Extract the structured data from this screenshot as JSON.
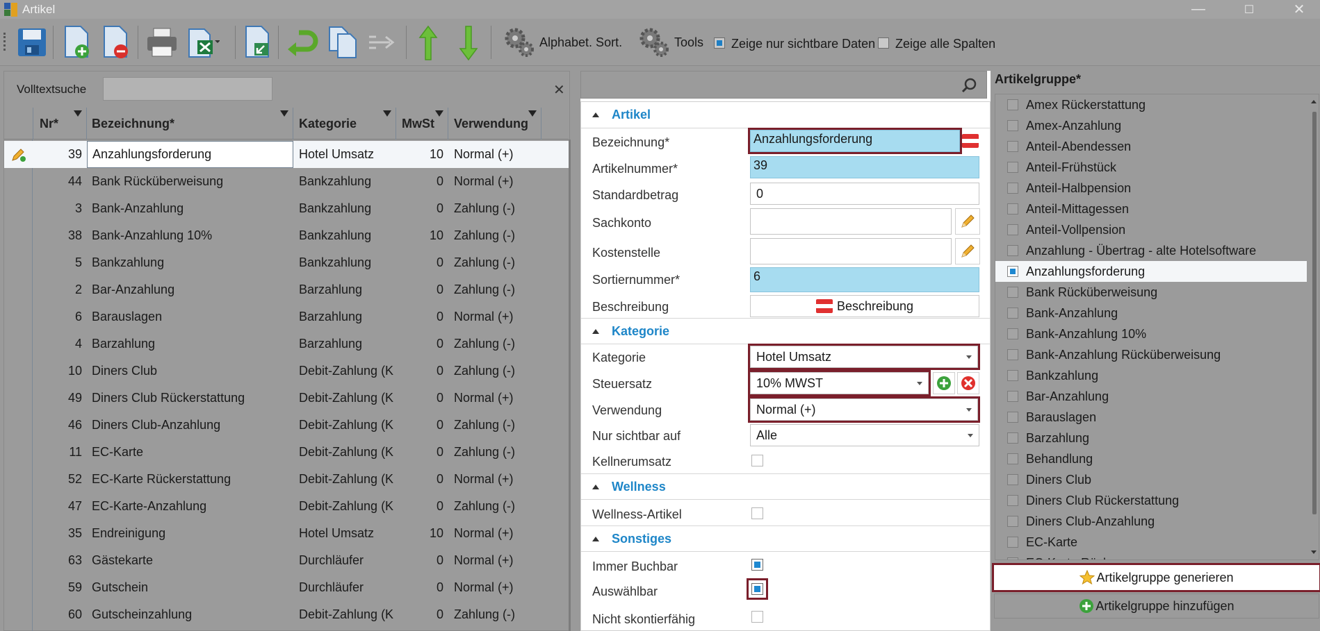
{
  "window": {
    "title": "Artikel",
    "minimize": "—",
    "maximize": "☐",
    "close": "✕"
  },
  "toolbar": {
    "alpha_sort_label": "Alphabet. Sort.",
    "tools_label": "Tools",
    "only_visible_label": "Zeige nur sichtbare Daten",
    "only_visible_checked": true,
    "all_columns_label": "Zeige alle Spalten",
    "all_columns_checked": false
  },
  "left": {
    "search_label": "Volltextsuche",
    "search_value": "",
    "close_glyph": "✕",
    "columns": [
      "Nr*",
      "Bezeichnung*",
      "Kategorie",
      "MwSt",
      "Verwendung"
    ],
    "rows": [
      {
        "nr": "39",
        "name": "Anzahlungsforderung",
        "kategorie": "Hotel Umsatz",
        "mwst": "10",
        "verwendung": "Normal (+)"
      },
      {
        "nr": "44",
        "name": "Bank Rücküberweisung",
        "kategorie": "Bankzahlung",
        "mwst": "0",
        "verwendung": "Normal (+)"
      },
      {
        "nr": "3",
        "name": "Bank-Anzahlung",
        "kategorie": "Bankzahlung",
        "mwst": "0",
        "verwendung": "Zahlung (-)"
      },
      {
        "nr": "38",
        "name": "Bank-Anzahlung 10%",
        "kategorie": "Bankzahlung",
        "mwst": "10",
        "verwendung": "Zahlung (-)"
      },
      {
        "nr": "5",
        "name": "Bankzahlung",
        "kategorie": "Bankzahlung",
        "mwst": "0",
        "verwendung": "Zahlung (-)"
      },
      {
        "nr": "2",
        "name": "Bar-Anzahlung",
        "kategorie": "Barzahlung",
        "mwst": "0",
        "verwendung": "Zahlung (-)"
      },
      {
        "nr": "6",
        "name": "Barauslagen",
        "kategorie": "Barzahlung",
        "mwst": "0",
        "verwendung": "Normal (+)"
      },
      {
        "nr": "4",
        "name": "Barzahlung",
        "kategorie": "Barzahlung",
        "mwst": "0",
        "verwendung": "Zahlung (-)"
      },
      {
        "nr": "10",
        "name": "Diners Club",
        "kategorie": "Debit-Zahlung (K",
        "mwst": "0",
        "verwendung": "Zahlung (-)"
      },
      {
        "nr": "49",
        "name": "Diners Club Rückerstattung",
        "kategorie": "Debit-Zahlung (K",
        "mwst": "0",
        "verwendung": "Normal (+)"
      },
      {
        "nr": "46",
        "name": "Diners Club-Anzahlung",
        "kategorie": "Debit-Zahlung (K",
        "mwst": "0",
        "verwendung": "Zahlung (-)"
      },
      {
        "nr": "11",
        "name": "EC-Karte",
        "kategorie": "Debit-Zahlung (K",
        "mwst": "0",
        "verwendung": "Zahlung (-)"
      },
      {
        "nr": "52",
        "name": "EC-Karte Rückerstattung",
        "kategorie": "Debit-Zahlung (K",
        "mwst": "0",
        "verwendung": "Normal (+)"
      },
      {
        "nr": "47",
        "name": "EC-Karte-Anzahlung",
        "kategorie": "Debit-Zahlung (K",
        "mwst": "0",
        "verwendung": "Zahlung (-)"
      },
      {
        "nr": "35",
        "name": "Endreinigung",
        "kategorie": "Hotel Umsatz",
        "mwst": "10",
        "verwendung": "Normal (+)"
      },
      {
        "nr": "63",
        "name": "Gästekarte",
        "kategorie": "Durchläufer",
        "mwst": "0",
        "verwendung": "Normal (+)"
      },
      {
        "nr": "59",
        "name": "Gutschein",
        "kategorie": "Durchläufer",
        "mwst": "0",
        "verwendung": "Normal (+)"
      },
      {
        "nr": "60",
        "name": "Gutscheinzahlung",
        "kategorie": "Debit-Zahlung (K",
        "mwst": "0",
        "verwendung": "Zahlung (-)"
      }
    ]
  },
  "form": {
    "search_value": "",
    "sections": {
      "artikel": "Artikel",
      "kategorie": "Kategorie",
      "wellness": "Wellness",
      "sonstiges": "Sonstiges"
    },
    "labels": {
      "bezeichnung": "Bezeichnung*",
      "artikelnummer": "Artikelnummer*",
      "standardbetrag": "Standardbetrag",
      "sachkonto": "Sachkonto",
      "kostenstelle": "Kostenstelle",
      "sortiernummer": "Sortiernummer*",
      "beschreibung": "Beschreibung",
      "kategorie": "Kategorie",
      "steuersatz": "Steuersatz",
      "verwendung": "Verwendung",
      "nur_sichtbar": "Nur sichtbar auf",
      "kellnerumsatz": "Kellnerumsatz",
      "wellness_artikel": "Wellness-Artikel",
      "immer_buchbar": "Immer Buchbar",
      "auswaehlbar": "Auswählbar",
      "nicht_skontierfaehig": "Nicht skontierfähig"
    },
    "values": {
      "bezeichnung": "Anzahlungsforderung",
      "artikelnummer": "39",
      "standardbetrag": "0",
      "sachkonto": "",
      "kostenstelle": "",
      "sortiernummer": "6",
      "beschreibung_button": "Beschreibung",
      "kategorie": "Hotel Umsatz",
      "steuersatz": "10% MWST",
      "verwendung": "Normal (+)",
      "nur_sichtbar": "Alle"
    },
    "checks": {
      "kellnerumsatz": false,
      "wellness_artikel": false,
      "immer_buchbar": true,
      "auswaehlbar": true,
      "nicht_skontierfaehig": false
    }
  },
  "right": {
    "title": "Artikelgruppe*",
    "items": [
      "Amex Rückerstattung",
      "Amex-Anzahlung",
      "Anteil-Abendessen",
      "Anteil-Frühstück",
      "Anteil-Halbpension",
      "Anteil-Mittagessen",
      "Anteil-Vollpension",
      "Anzahlung - Übertrag - alte Hotelsoftware",
      "Anzahlungsforderung",
      "Bank Rücküberweisung",
      "Bank-Anzahlung",
      "Bank-Anzahlung 10%",
      "Bank-Anzahlung Rücküberweisung",
      "Bankzahlung",
      "Bar-Anzahlung",
      "Barauslagen",
      "Barzahlung",
      "Behandlung",
      "Diners Club",
      "Diners Club Rückerstattung",
      "Diners Club-Anzahlung",
      "EC-Karte",
      "EC-Karte Rück"
    ],
    "selected_index": 8,
    "generate_button": "Artikelgruppe generieren",
    "add_button": "Artikelgruppe hinzufügen"
  },
  "colors": {
    "accent": "#1e86c8",
    "required_field": "#a7dcf0",
    "highlight_border": "#7a1f2b",
    "disabled_overlay": "#9b9b9b"
  }
}
